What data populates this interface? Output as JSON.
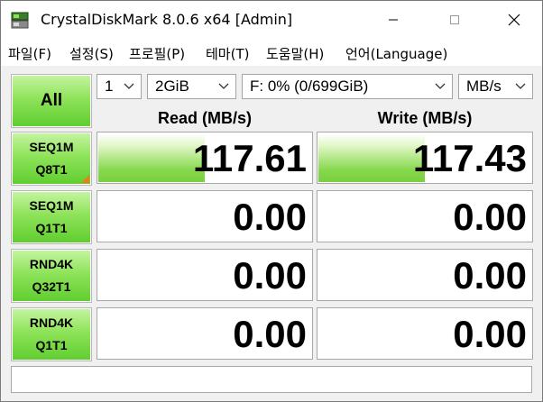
{
  "window": {
    "title": "CrystalDiskMark 8.0.6 x64 [Admin]"
  },
  "menu": [
    {
      "label": "파일(F)"
    },
    {
      "label": "설정(S)"
    },
    {
      "label": "프로필(P)"
    },
    {
      "label": "테마(T)"
    },
    {
      "label": "도움말(H)"
    },
    {
      "label": "언어(Language)"
    }
  ],
  "controls": {
    "all_label": "All",
    "count": "1",
    "size": "2GiB",
    "drive": "F: 0% (0/699GiB)",
    "unit": "MB/s"
  },
  "columns": {
    "read": "Read (MB/s)",
    "write": "Write (MB/s)"
  },
  "tests": [
    {
      "line1": "SEQ1M",
      "line2": "Q8T1",
      "read": "117.61",
      "write": "117.43",
      "read_fill": 0.5,
      "write_fill": 0.5
    },
    {
      "line1": "SEQ1M",
      "line2": "Q1T1",
      "read": "0.00",
      "write": "0.00",
      "read_fill": 0,
      "write_fill": 0
    },
    {
      "line1": "RND4K",
      "line2": "Q32T1",
      "read": "0.00",
      "write": "0.00",
      "read_fill": 0,
      "write_fill": 0
    },
    {
      "line1": "RND4K",
      "line2": "Q1T1",
      "read": "0.00",
      "write": "0.00",
      "read_fill": 0,
      "write_fill": 0
    }
  ],
  "status": "",
  "colors": {
    "button_green": "#5fcd2f",
    "bar_green": "#79cf3e",
    "accent_orange": "#f07a1c"
  }
}
